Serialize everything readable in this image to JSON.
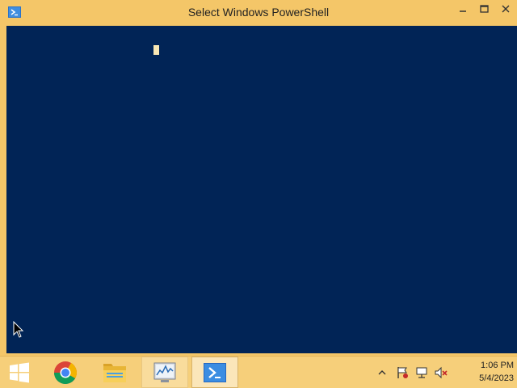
{
  "window": {
    "title": "Select Windows PowerShell",
    "icon": "powershell-icon",
    "controls": {
      "minimize": "minimize-icon",
      "maximize": "maximize-icon",
      "close": "close-icon"
    }
  },
  "console": {
    "background": "#012456",
    "caret_color": "#f8e7b4"
  },
  "taskbar": {
    "items": [
      {
        "name": "start",
        "icon": "windows-logo-icon"
      },
      {
        "name": "chrome",
        "icon": "chrome-icon"
      },
      {
        "name": "file-explorer",
        "icon": "folder-icon"
      },
      {
        "name": "resource-monitor",
        "icon": "resource-monitor-icon"
      },
      {
        "name": "powershell",
        "icon": "powershell-icon",
        "active": true
      }
    ],
    "tray": {
      "icons": [
        "show-hidden-icons-chevron",
        "action-center-flag-icon",
        "network-icon",
        "volume-muted-icon"
      ]
    },
    "clock": {
      "time": "1:06 PM",
      "date": "5/4/2023"
    }
  },
  "colors": {
    "accent": "#f4c668",
    "console": "#012456"
  }
}
